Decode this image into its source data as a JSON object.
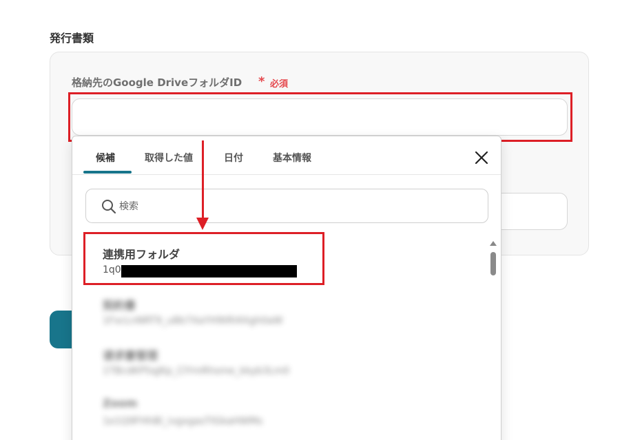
{
  "section_title": "発行書類",
  "field": {
    "label": "格納先のGoogle DriveフォルダID",
    "required_mark": "*",
    "required_text": "必須",
    "value": ""
  },
  "dropdown": {
    "tabs": [
      {
        "label": "候補",
        "active": true
      },
      {
        "label": "取得した値",
        "active": false
      },
      {
        "label": "日付",
        "active": false
      },
      {
        "label": "基本情報",
        "active": false
      }
    ],
    "search_placeholder": "検索",
    "items": [
      {
        "title": "連携用フォルダ",
        "id_prefix": "1q0",
        "redacted": true
      },
      {
        "title": "契約書",
        "id": "1FxcLnNRT9_u8b7XaYH9tRl4Xgh0aW",
        "blurred": true
      },
      {
        "title": "请求書管理",
        "id": "1TBcdKP5qjKp_ClYmRhsme_kkyb3Lm0",
        "blurred": true
      },
      {
        "title": "Zoom",
        "id": "1e1Q9FHhBl_ivgxgasTIGkaHWMs",
        "blurred": true
      }
    ]
  },
  "colors": {
    "accent": "#18758b",
    "required": "#e5484d",
    "annotation": "#dd1f26"
  }
}
